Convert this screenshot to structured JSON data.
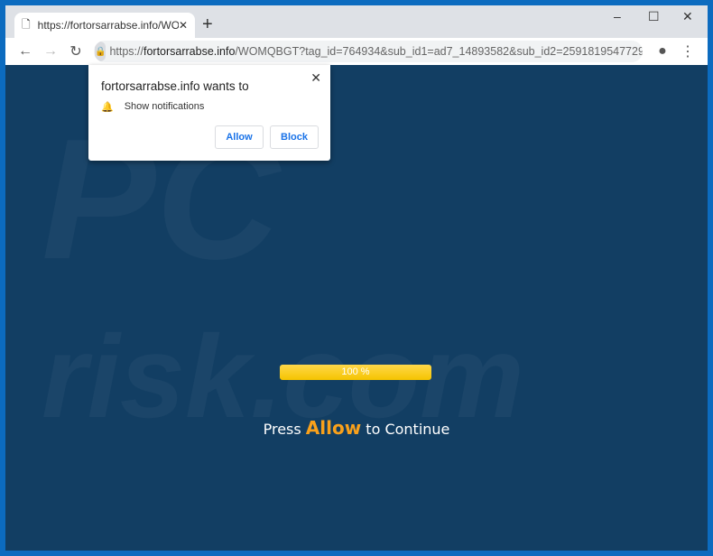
{
  "tab": {
    "title": "https://fortorsarrabse.info/WOMQBGT"
  },
  "omnibox": {
    "host": "fortorsarrabse.info",
    "prefix": "https://",
    "path": "/WOMQBGT?tag_id=764934&sub_id1=ad7_14893582&sub_id2=2591819547729..."
  },
  "popup": {
    "title": "fortorsarrabse.info wants to",
    "permission": "Show notifications",
    "allow": "Allow",
    "block": "Block"
  },
  "progress": {
    "label": "100 %",
    "value": 100,
    "color": "#f5c400"
  },
  "message": {
    "before": "Press",
    "highlight": "Allow",
    "after": "to Continue"
  },
  "watermark": "PC risk.com"
}
